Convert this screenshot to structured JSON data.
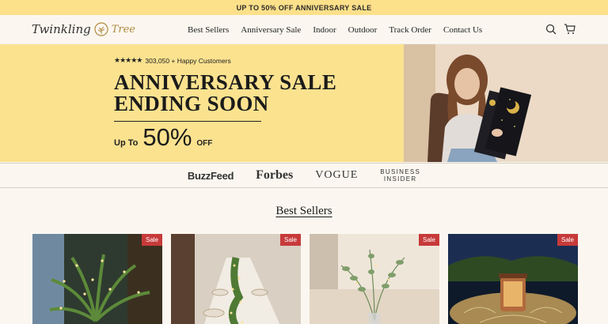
{
  "announcement": "UP TO 50% OFF ANNIVERSARY SALE",
  "logo": {
    "word1": "Twinkling",
    "word2": "Tree"
  },
  "nav": [
    "Best Sellers",
    "Anniversary Sale",
    "Indoor",
    "Outdoor",
    "Track Order",
    "Contact Us"
  ],
  "hero": {
    "stars": "★★★★★",
    "rating_text": "303,050 + Happy Customers",
    "title_line1": "ANNIVERSARY SALE",
    "title_line2": "ENDING SOON",
    "up_to": "Up To",
    "percent": "50%",
    "off": "OFF"
  },
  "press": {
    "buzzfeed": "BuzzFeed",
    "forbes": "Forbes",
    "vogue": "VOGUE",
    "bi_line1": "BUSINESS",
    "bi_line2": "INSIDER"
  },
  "section": {
    "title": "Best Sellers"
  },
  "products": [
    {
      "badge": "Sale"
    },
    {
      "badge": "Sale"
    },
    {
      "badge": "Sale"
    },
    {
      "badge": "Sale"
    }
  ],
  "colors": {
    "announcement_bg": "#fde08a",
    "hero_bg": "#fbe28f",
    "sale_badge": "#c73a3a",
    "page_bg": "#fbf7f0"
  }
}
